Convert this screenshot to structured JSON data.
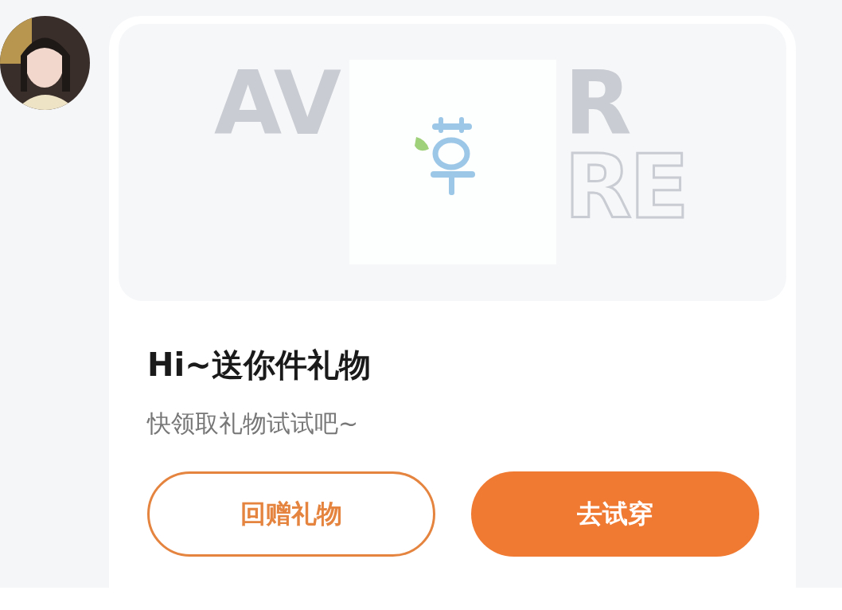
{
  "message": {
    "card": {
      "banner": {
        "backdrop_words": [
          "AV",
          "R",
          "RE"
        ]
      },
      "title": "Hi~送你件礼物",
      "subtitle": "快领取礼物试试吧~",
      "buttons": [
        {
          "label": "回赠礼物",
          "kind": "outline"
        },
        {
          "label": "去试穿",
          "kind": "filled"
        }
      ]
    }
  }
}
